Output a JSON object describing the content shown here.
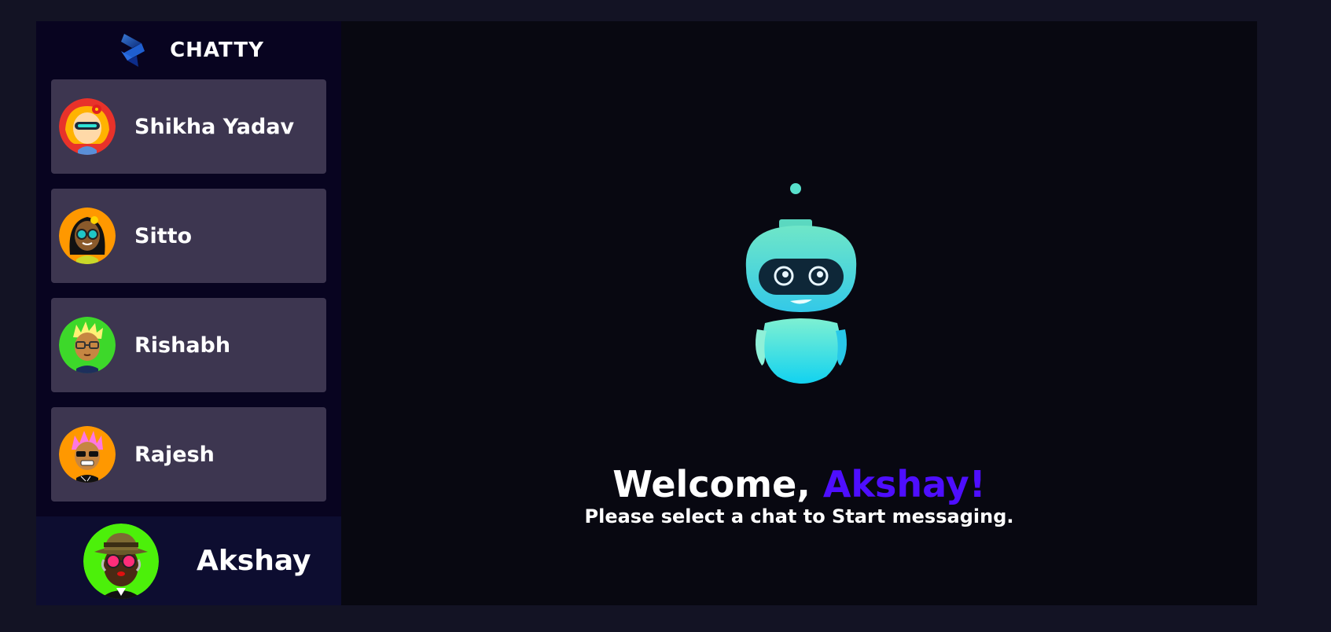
{
  "brand": {
    "name": "CHATTY",
    "logo_icon": "chatty-logo-icon"
  },
  "contacts": [
    {
      "name": "Shikha Yadav",
      "avatar_icon": "avatar-girl-visor-icon",
      "avatar_bg": "#e8322a"
    },
    {
      "name": "Sitto",
      "avatar_icon": "avatar-girl-sunglasses-icon",
      "avatar_bg": "#ff9800"
    },
    {
      "name": "Rishabh",
      "avatar_icon": "avatar-boy-glasses-icon",
      "avatar_bg": "#3dd82a"
    },
    {
      "name": "Rajesh",
      "avatar_icon": "avatar-punk-sunglasses-icon",
      "avatar_bg": "#ff9800"
    }
  ],
  "current_user": {
    "name": "Akshay",
    "avatar_icon": "avatar-hat-sunglasses-icon",
    "avatar_bg": "#4cf00a"
  },
  "welcome": {
    "greeting": "Welcome, ",
    "user_name": "Akshay!",
    "subtitle": "Please select a chat to Start messaging.",
    "illustration": "robot-icon"
  },
  "colors": {
    "page_bg": "#131324",
    "sidebar_bg": "#080420",
    "contact_card_bg": "#3d3650",
    "current_user_bg": "#0d0d30",
    "main_bg": "#080811",
    "accent": "#4e0eff"
  }
}
